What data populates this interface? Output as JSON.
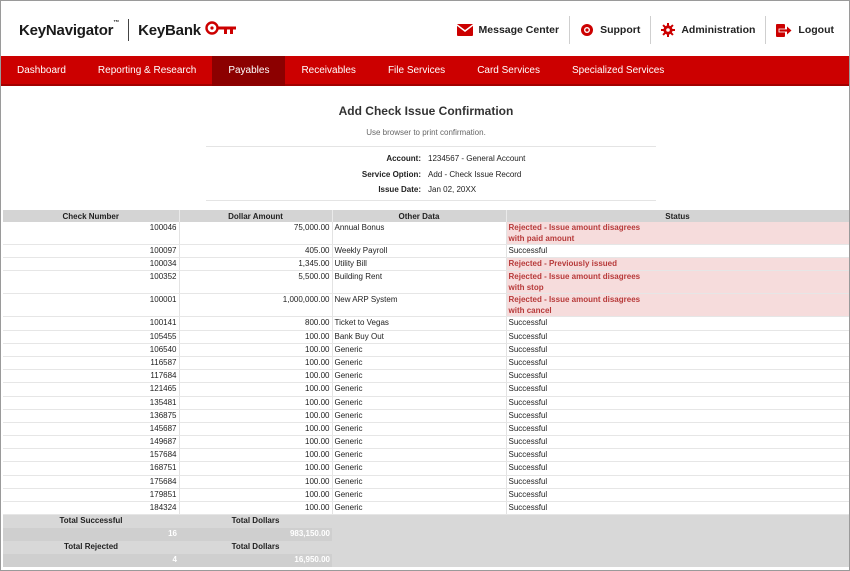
{
  "brand": {
    "product": "KeyNavigator",
    "tm": "™",
    "bank": "KeyBank"
  },
  "utility": [
    {
      "label": "Message Center",
      "icon": "envelope-icon"
    },
    {
      "label": "Support",
      "icon": "lifebuoy-icon"
    },
    {
      "label": "Administration",
      "icon": "gear-icon"
    },
    {
      "label": "Logout",
      "icon": "logout-icon"
    }
  ],
  "nav": [
    {
      "label": "Dashboard"
    },
    {
      "label": "Reporting & Research"
    },
    {
      "label": "Payables",
      "active": true
    },
    {
      "label": "Receivables"
    },
    {
      "label": "File Services"
    },
    {
      "label": "Card Services"
    },
    {
      "label": "Specialized Services"
    }
  ],
  "page": {
    "title": "Add Check Issue Confirmation",
    "subtitle": "Use browser to print confirmation."
  },
  "meta": [
    {
      "label": "Account:",
      "value": "1234567 - General Account"
    },
    {
      "label": "Service Option:",
      "value": "Add - Check Issue Record"
    },
    {
      "label": "Issue Date:",
      "value": "Jan 02, 20XX"
    }
  ],
  "table": {
    "headers": [
      "Check Number",
      "Dollar Amount",
      "Other Data",
      "Status"
    ],
    "rows": [
      {
        "check": "100046",
        "amount": "75,000.00",
        "other": "Annual Bonus",
        "status": "Rejected - Issue amount disagrees with paid amount",
        "status_lines": [
          "Rejected - Issue amount disagrees",
          "with paid amount"
        ],
        "rejected": true
      },
      {
        "check": "100097",
        "amount": "405.00",
        "other": "Weekly Payroll",
        "status": "Successful"
      },
      {
        "check": "100034",
        "amount": "1,345.00",
        "other": "Utility Bill",
        "status": "Rejected - Previously issued",
        "rejected": true
      },
      {
        "check": "100352",
        "amount": "5,500.00",
        "other": "Building Rent",
        "status": "Rejected - Issue amount disagrees with stop",
        "status_lines": [
          "Rejected - Issue amount disagrees",
          "with stop"
        ],
        "rejected": true
      },
      {
        "check": "100001",
        "amount": "1,000,000.00",
        "other": "New ARP System",
        "status": "Rejected - Issue amount disagrees with cancel",
        "status_lines": [
          "Rejected - Issue amount disagrees",
          "with cancel"
        ],
        "rejected": true
      },
      {
        "check": "100141",
        "amount": "800.00",
        "other": "Ticket to Vegas",
        "status": "Successful"
      },
      {
        "check": "105455",
        "amount": "100.00",
        "other": "Bank Buy Out",
        "status": "Successful"
      },
      {
        "check": "106540",
        "amount": "100.00",
        "other": "Generic",
        "status": "Successful"
      },
      {
        "check": "116587",
        "amount": "100.00",
        "other": "Generic",
        "status": "Successful"
      },
      {
        "check": "117684",
        "amount": "100.00",
        "other": "Generic",
        "status": "Successful"
      },
      {
        "check": "121465",
        "amount": "100.00",
        "other": "Generic",
        "status": "Successful"
      },
      {
        "check": "135481",
        "amount": "100.00",
        "other": "Generic",
        "status": "Successful"
      },
      {
        "check": "136875",
        "amount": "100.00",
        "other": "Generic",
        "status": "Successful"
      },
      {
        "check": "145687",
        "amount": "100.00",
        "other": "Generic",
        "status": "Successful"
      },
      {
        "check": "149687",
        "amount": "100.00",
        "other": "Generic",
        "status": "Successful"
      },
      {
        "check": "157684",
        "amount": "100.00",
        "other": "Generic",
        "status": "Successful"
      },
      {
        "check": "168751",
        "amount": "100.00",
        "other": "Generic",
        "status": "Successful"
      },
      {
        "check": "175684",
        "amount": "100.00",
        "other": "Generic",
        "status": "Successful"
      },
      {
        "check": "179851",
        "amount": "100.00",
        "other": "Generic",
        "status": "Successful"
      },
      {
        "check": "184324",
        "amount": "100.00",
        "other": "Generic",
        "status": "Successful"
      }
    ],
    "totals": {
      "successful_label": "Total Successful",
      "successful_dollars_label": "Total Dollars",
      "successful_count": "16",
      "successful_dollars": "983,150.00",
      "rejected_label": "Total Rejected",
      "rejected_dollars_label": "Total Dollars",
      "rejected_count": "4",
      "rejected_dollars": "16,950.00"
    }
  },
  "colors": {
    "brand_red": "#cc0000",
    "nav_active": "#8c0000",
    "rejected_bg": "#f6dcdc",
    "rejected_text": "#b73a3a"
  }
}
